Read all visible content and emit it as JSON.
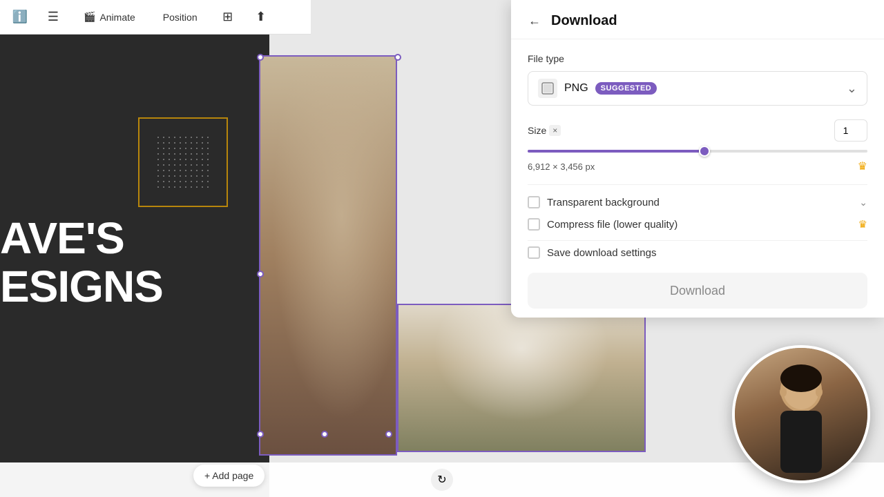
{
  "toolbar": {
    "info_icon": "ℹ",
    "menu_icon": "☰",
    "animate_label": "Animate",
    "position_label": "Position",
    "grid_icon": "⊞",
    "share_icon": "↑"
  },
  "canvas": {
    "title_line1": "AVE'S",
    "title_line2": "ESIGNS",
    "add_page_label": "+ Add page"
  },
  "download_panel": {
    "title": "Download",
    "back_icon": "←",
    "file_type_label": "File type",
    "file_icon": "🖼",
    "file_name": "PNG",
    "suggested_label": "SUGGESTED",
    "size_label": "Size",
    "size_x": "×",
    "size_value": "1",
    "size_dimensions": "6,912 × 3,456 px",
    "slider_percent": 52,
    "transparent_bg_label": "Transparent background",
    "compress_label": "Compress file (lower quality)",
    "save_settings_label": "Save download settings",
    "download_button_label": "Download",
    "crown_color": "#f0a500"
  },
  "webcam": {
    "visible": true
  }
}
